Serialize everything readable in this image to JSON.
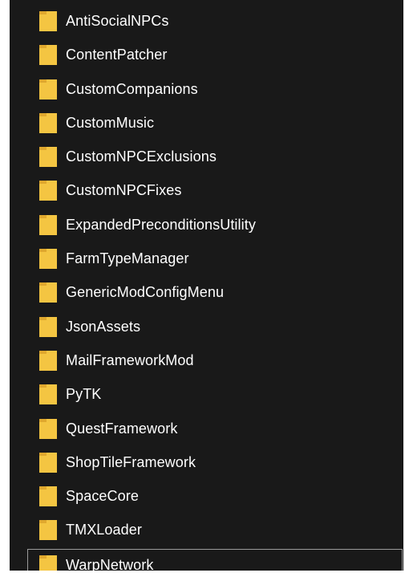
{
  "folders": [
    {
      "name": "AntiSocialNPCs",
      "icon": "folder-icon"
    },
    {
      "name": "ContentPatcher",
      "icon": "folder-icon"
    },
    {
      "name": "CustomCompanions",
      "icon": "folder-icon"
    },
    {
      "name": "CustomMusic",
      "icon": "folder-icon"
    },
    {
      "name": "CustomNPCExclusions",
      "icon": "folder-icon"
    },
    {
      "name": "CustomNPCFixes",
      "icon": "folder-icon"
    },
    {
      "name": "ExpandedPreconditionsUtility",
      "icon": "folder-icon"
    },
    {
      "name": "FarmTypeManager",
      "icon": "folder-icon"
    },
    {
      "name": "GenericModConfigMenu",
      "icon": "folder-icon"
    },
    {
      "name": "JsonAssets",
      "icon": "folder-icon"
    },
    {
      "name": "MailFrameworkMod",
      "icon": "folder-icon"
    },
    {
      "name": "PyTK",
      "icon": "folder-icon"
    },
    {
      "name": "QuestFramework",
      "icon": "folder-icon"
    },
    {
      "name": "ShopTileFramework",
      "icon": "folder-icon"
    },
    {
      "name": "SpaceCore",
      "icon": "folder-icon"
    },
    {
      "name": "TMXLoader",
      "icon": "folder-icon"
    },
    {
      "name": "WarpNetwork",
      "icon": "folder-icon",
      "focused": true
    }
  ],
  "colors": {
    "background": "#191919",
    "text": "#ffffff",
    "folder_body": "#f4c542",
    "folder_tab": "#e0a82e",
    "focus_border": "#9b9b9b"
  }
}
